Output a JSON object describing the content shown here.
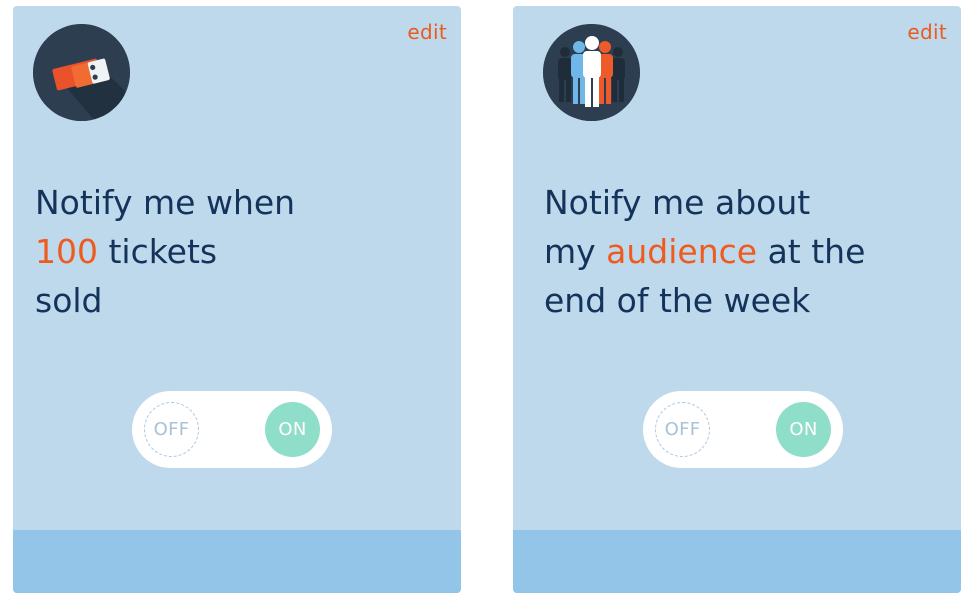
{
  "colors": {
    "card_bg": "#bed9ec",
    "card_footer": "#93c5e8",
    "accent": "#e95b1e",
    "headline_text": "#14335a",
    "toggle_on": "#8fdec9"
  },
  "cards": [
    {
      "icon": "tickets-icon",
      "edit_label": "edit",
      "headline": {
        "part1": "Notify me when",
        "highlight": "100",
        "part2": " tickets",
        "part3": "sold"
      },
      "toggle": {
        "off_label": "OFF",
        "on_label": "ON",
        "state": "on"
      }
    },
    {
      "icon": "audience-icon",
      "edit_label": "edit",
      "headline": {
        "part1": "Notify me about",
        "part2": "my ",
        "highlight": "audience",
        "part3": " at the",
        "part4": "end of the week"
      },
      "toggle": {
        "off_label": "OFF",
        "on_label": "ON",
        "state": "on"
      }
    }
  ]
}
